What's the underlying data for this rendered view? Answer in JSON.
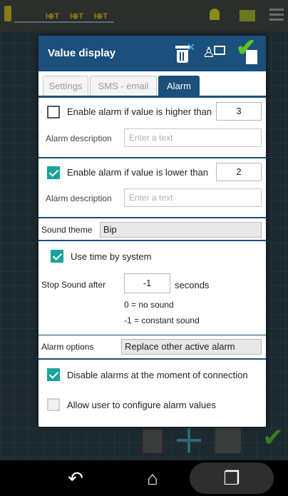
{
  "dialog": {
    "title": "Value display",
    "tabs": [
      {
        "label": "Settings",
        "active": false
      },
      {
        "label": "SMS - email",
        "active": false
      },
      {
        "label": "Alarm",
        "active": true
      }
    ]
  },
  "alarm": {
    "high": {
      "enabled": false,
      "label": "Enable alarm if value is higher than",
      "value": "3",
      "description_label": "Alarm description",
      "description_placeholder": "Enter a text"
    },
    "low": {
      "enabled": true,
      "label": "Enable alarm if value is lower than",
      "value": "2",
      "description_label": "Alarm description",
      "description_placeholder": "Enter a text"
    },
    "sound_theme": {
      "label": "Sound theme",
      "value": "Bip"
    },
    "use_time_by_system": {
      "enabled": true,
      "label": "Use time by system"
    },
    "stop_sound": {
      "label": "Stop Sound after",
      "value": "-1",
      "unit": "seconds",
      "hint_1": "0 = no sound",
      "hint_2": "-1 = constant sound"
    },
    "alarm_options": {
      "label": "Alarm options",
      "value": "Replace other active alarm"
    },
    "disable_at_connection": {
      "enabled": true,
      "label": "Disable alarms at the moment of connection"
    },
    "allow_user_configure": {
      "enabled": false,
      "label": "Allow user to configure alarm values"
    }
  },
  "colors": {
    "header": "#1b4f7c",
    "checkbox_checked": "#1aa39a",
    "confirm_green": "#5cc227"
  },
  "icons": {
    "header_actions": [
      "trash-icon",
      "user-config-icon",
      "confirm-icon"
    ],
    "navbar": [
      "back-icon",
      "home-icon",
      "recent-apps-icon"
    ]
  }
}
